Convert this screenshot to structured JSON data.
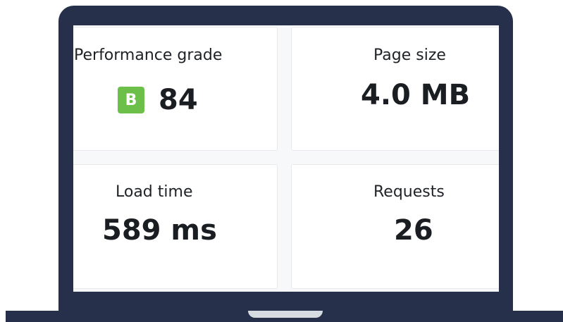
{
  "metrics": {
    "performance": {
      "label": "Performance grade",
      "grade": "B",
      "value": "84",
      "grade_color": "#6cc04a"
    },
    "page_size": {
      "label": "Page size",
      "value": "4.0 MB"
    },
    "load_time": {
      "label": "Load time",
      "value": "589 ms"
    },
    "requests": {
      "label": "Requests",
      "value": "26"
    }
  },
  "colors": {
    "laptop_frame": "#26304b",
    "trackpad_notch": "#d7dbe2",
    "screen_background": "#f7f8f9",
    "card_background": "#ffffff",
    "text": "#1a1d21"
  }
}
